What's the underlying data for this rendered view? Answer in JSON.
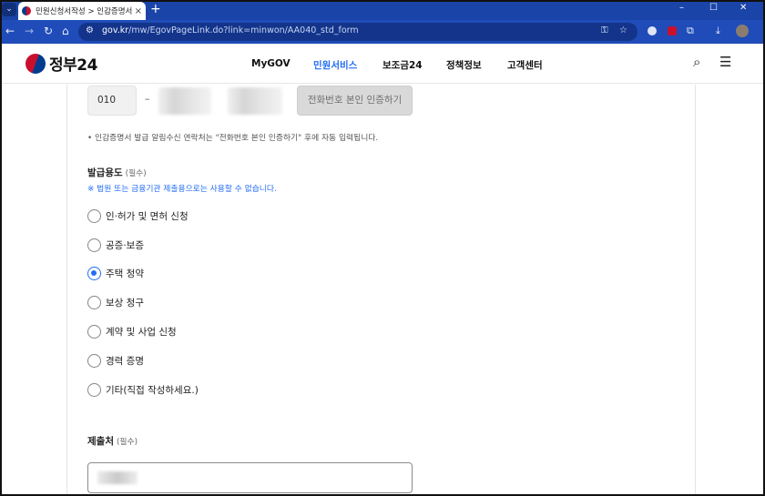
{
  "browser": {
    "tab_title": "민원신청서작성 > 인감증명서",
    "tab_close": "×",
    "new_tab": "+",
    "tab_menu": "⌄",
    "window_controls": {
      "minimize": "–",
      "maximize": "☐",
      "close": "✕"
    },
    "nav": {
      "back": "←",
      "forward": "→",
      "reload": "↻",
      "home": "⌂"
    },
    "url_host": "gov.kr",
    "url_path": "/mw/EgovPageLink.do?link=minwon/AA040_std_form",
    "omnibox_icons": {
      "site_info": "⚙",
      "password_key": "⚿",
      "bookmark": "☆"
    }
  },
  "header": {
    "logo_text": "정부24",
    "nav": [
      "MyGOV",
      "민원서비스",
      "보조금24",
      "정책정보",
      "고객센터"
    ],
    "active_nav": "민원서비스",
    "search_icon": "⌕",
    "menu_icon": "☰"
  },
  "phone": {
    "prefix": "010",
    "separator": "–",
    "verify_button": "전화번호 본인 인증하기",
    "notice": "• 인감증명서 발급 알림수신 연락처는 \"전화번호 본인 인증하기\" 후에 자동 입력됩니다."
  },
  "purpose": {
    "title": "발급용도",
    "required": "(필수)",
    "warning": "※ 법원 또는 금융기관 제출용으로는 사용할 수 없습니다.",
    "options": [
      "인·허가 및 면허 신청",
      "공증·보증",
      "주택 청약",
      "보상 청구",
      "계약 및 사업 신청",
      "경력 증명",
      "기타(직접 작성하세요.)"
    ],
    "selected": "주택 청약"
  },
  "submit_to": {
    "title": "제출처",
    "required": "(필수)"
  },
  "colors": {
    "chrome_blue": "#1f4cb8",
    "accent": "#256ef4",
    "button_disabled": "#d9d9d9"
  }
}
